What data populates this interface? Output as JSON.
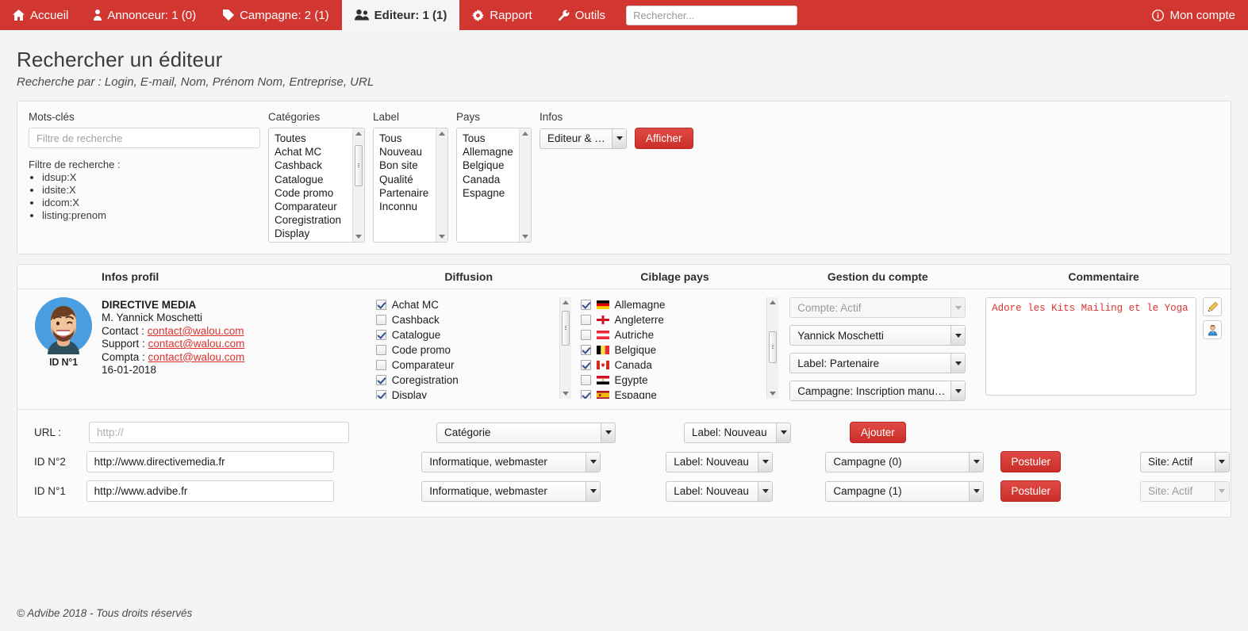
{
  "nav": {
    "items": [
      {
        "label": "Accueil",
        "icon": "home-icon",
        "active": false
      },
      {
        "label": "Annonceur: 1 (0)",
        "icon": "person-icon",
        "active": false
      },
      {
        "label": "Campagne: 2 (1)",
        "icon": "tag-icon",
        "active": false
      },
      {
        "label": "Editeur: 1 (1)",
        "icon": "users-icon",
        "active": true
      },
      {
        "label": "Rapport",
        "icon": "gear-icon",
        "active": false
      },
      {
        "label": "Outils",
        "icon": "wrench-icon",
        "active": false
      }
    ],
    "search_placeholder": "Rechercher...",
    "account_label": "Mon compte",
    "brand_color": "#d13631"
  },
  "page": {
    "title": "Rechercher un éditeur",
    "subtitle": "Recherche par : Login, E-mail, Nom, Prénom Nom, Entreprise, URL"
  },
  "filters": {
    "keywords": {
      "label": "Mots-clés",
      "placeholder": "Filtre de recherche",
      "value": "",
      "hint_title": "Filtre de recherche :",
      "hints": [
        "idsup:X",
        "idsite:X",
        "idcom:X",
        "listing:prenom"
      ]
    },
    "categories": {
      "label": "Catégories",
      "options": [
        "Toutes",
        "Achat MC",
        "Cashback",
        "Catalogue",
        "Code promo",
        "Comparateur",
        "Coregistration",
        "Display"
      ]
    },
    "label": {
      "label": "Label",
      "options": [
        "Tous",
        "Nouveau",
        "Bon site",
        "Qualité",
        "Partenaire",
        "Inconnu"
      ]
    },
    "pays": {
      "label": "Pays",
      "options": [
        "Tous",
        "Allemagne",
        "Belgique",
        "Canada",
        "Espagne"
      ]
    },
    "infos": {
      "label": "Infos",
      "selected": "Editeur & URL",
      "submit_label": "Afficher"
    }
  },
  "results": {
    "headers": {
      "profil": "Infos profil",
      "diffusion": "Diffusion",
      "ciblage": "Ciblage pays",
      "gestion": "Gestion du compte",
      "commentaire": "Commentaire"
    },
    "row": {
      "avatar_id": "ID N°1",
      "company": "DIRECTIVE MEDIA",
      "person": "M. Yannick Moschetti",
      "contact_label": "Contact :",
      "contact_email": "contact@walou.com",
      "support_label": "Support :",
      "support_email": "contact@walou.com",
      "compta_label": "Compta :",
      "compta_email": "contact@walou.com",
      "date": "16-01-2018",
      "diffusion": [
        {
          "label": "Achat MC",
          "checked": true
        },
        {
          "label": "Cashback",
          "checked": false
        },
        {
          "label": "Catalogue",
          "checked": true
        },
        {
          "label": "Code promo",
          "checked": false
        },
        {
          "label": "Comparateur",
          "checked": false
        },
        {
          "label": "Coregistration",
          "checked": true
        },
        {
          "label": "Display",
          "checked": true
        }
      ],
      "ciblage": [
        {
          "label": "Allemagne",
          "checked": true,
          "flag": "de"
        },
        {
          "label": "Angleterre",
          "checked": false,
          "flag": "en"
        },
        {
          "label": "Autriche",
          "checked": false,
          "flag": "at"
        },
        {
          "label": "Belgique",
          "checked": true,
          "flag": "be"
        },
        {
          "label": "Canada",
          "checked": true,
          "flag": "ca"
        },
        {
          "label": "Egypte",
          "checked": false,
          "flag": "eg"
        },
        {
          "label": "Espagne",
          "checked": true,
          "flag": "es"
        }
      ],
      "gestion": [
        {
          "value": "Compte: Actif",
          "disabled": true
        },
        {
          "value": "Yannick Moschetti",
          "disabled": false
        },
        {
          "value": "Label: Partenaire",
          "disabled": false
        },
        {
          "value": "Campagne: Inscription manuelle",
          "disabled": false
        }
      ],
      "commentaire": "Adore les Kits Mailing et le Yoga",
      "edit_icon": "pencil-icon",
      "user_icon": "user-icon"
    }
  },
  "urls": {
    "rows": [
      {
        "label": "URL :",
        "url_value": "",
        "url_placeholder": "http://",
        "category": "Catégorie",
        "label_sel": "Label: Nouveau",
        "action_label": "Ajouter",
        "campaign": null,
        "postuler": null,
        "site": null,
        "site_disabled": false
      },
      {
        "label": "ID N°2",
        "url_value": "http://www.directivemedia.fr",
        "url_placeholder": "",
        "category": "Informatique, webmaster",
        "label_sel": "Label: Nouveau",
        "action_label": null,
        "campaign": "Campagne (0)",
        "postuler": "Postuler",
        "site": "Site: Actif",
        "site_disabled": false
      },
      {
        "label": "ID N°1",
        "url_value": "http://www.advibe.fr",
        "url_placeholder": "",
        "category": "Informatique, webmaster",
        "label_sel": "Label: Nouveau",
        "action_label": null,
        "campaign": "Campagne (1)",
        "postuler": "Postuler",
        "site": "Site: Actif",
        "site_disabled": true
      }
    ]
  },
  "footer": {
    "text": "© Advibe 2018 - Tous droits réservés"
  }
}
